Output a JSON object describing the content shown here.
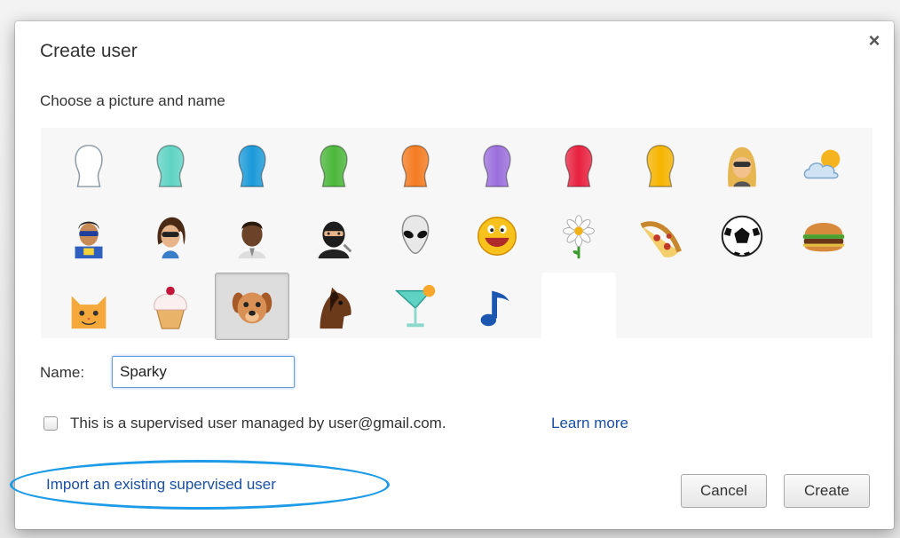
{
  "dialog": {
    "title": "Create user",
    "close_symbol": "×",
    "subtitle": "Choose a picture and name",
    "avatars": [
      {
        "icon": "white-silhouette-icon",
        "color": "#ffffff"
      },
      {
        "icon": "teal-silhouette-icon",
        "color": "#5fd3c4"
      },
      {
        "icon": "blue-silhouette-icon",
        "color": "#1a9ad9"
      },
      {
        "icon": "green-silhouette-icon",
        "color": "#4bb73a"
      },
      {
        "icon": "orange-silhouette-icon",
        "color": "#f47b20"
      },
      {
        "icon": "purple-silhouette-icon",
        "color": "#9b6fdc"
      },
      {
        "icon": "red-silhouette-icon",
        "color": "#e8213f"
      },
      {
        "icon": "yellow-silhouette-icon",
        "color": "#f6b400"
      },
      {
        "icon": "blonde-woman-sunglasses-icon"
      },
      {
        "icon": "sun-cloud-icon"
      },
      {
        "icon": "superhero-icon"
      },
      {
        "icon": "woman-sunglasses-icon"
      },
      {
        "icon": "businessman-icon"
      },
      {
        "icon": "ninja-icon"
      },
      {
        "icon": "alien-icon"
      },
      {
        "icon": "smiley-face-icon"
      },
      {
        "icon": "daisy-flower-icon"
      },
      {
        "icon": "pizza-slice-icon"
      },
      {
        "icon": "soccer-ball-icon"
      },
      {
        "icon": "hamburger-icon"
      },
      {
        "icon": "cat-icon"
      },
      {
        "icon": "cupcake-icon"
      },
      {
        "icon": "dog-icon",
        "selected": true
      },
      {
        "icon": "horse-icon"
      },
      {
        "icon": "cocktail-icon"
      },
      {
        "icon": "music-note-icon"
      },
      {
        "icon": "blank-avatar"
      }
    ],
    "name_label": "Name:",
    "name_value": "Sparky",
    "supervised_checked": false,
    "supervised_text": "This is a supervised user managed by user@gmail.com.",
    "learn_more": "Learn more",
    "import_link": "Import an existing supervised user",
    "cancel_label": "Cancel",
    "create_label": "Create"
  }
}
